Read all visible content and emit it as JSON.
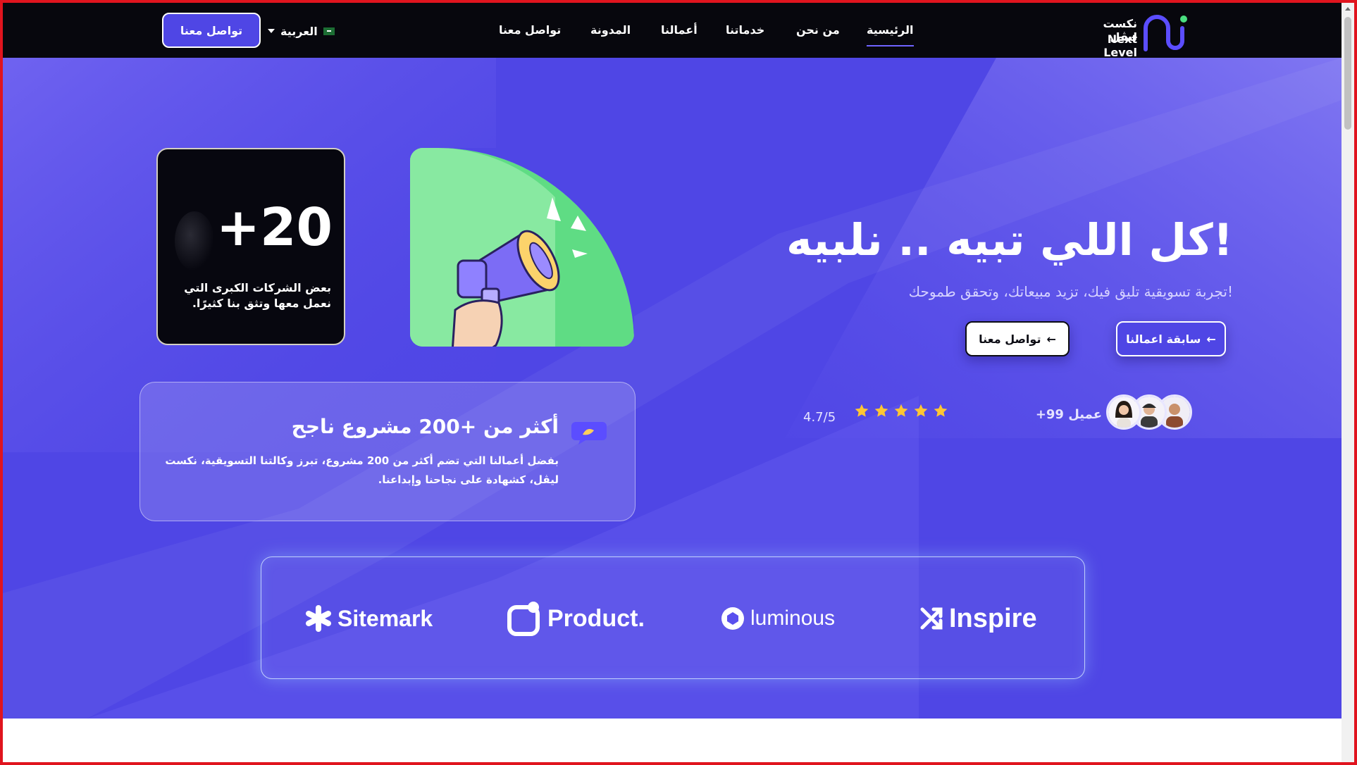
{
  "nav": {
    "logo_ar": "نكست ليڤل",
    "logo_en": "Next Level",
    "links": [
      {
        "label": "الرئيسية",
        "active": true
      },
      {
        "label": "من نحن"
      },
      {
        "label": "خدماتنا"
      },
      {
        "label": "أعمالنا"
      },
      {
        "label": "المدونة"
      },
      {
        "label": "تواصل معنا"
      }
    ],
    "language": "العربية",
    "cta": "تواصل معنا"
  },
  "hero": {
    "title": "كل اللي تبيه .. نلبيه!",
    "subtitle": "تجربة تسويقية تليق فيك، تزيد مبيعاتك، وتحقق طموحك!",
    "btn_works": "سابقة اعمالنا",
    "btn_contact": "تواصل معنا",
    "clients": "+99 عميل",
    "rating": "4.7/5",
    "stars": 5
  },
  "stat_card": {
    "number": "+20",
    "text": "بعض الشركات الكبرى التي نعمل معها وتثق بنا كثيرًا."
  },
  "projects_card": {
    "title": "أكثر من +200 مشروع ناجح",
    "text": "بفضل أعمالنا التي تضم أكثر من 200 مشروع، تبرز وكالتنا التسويقية، نكست ليڤل، كشهادة على نجاحنا وإبداعنا."
  },
  "brands": [
    {
      "name": "Sitemark",
      "icon": "asterisk-icon"
    },
    {
      "name": "Product.",
      "icon": "rounded-square-icon"
    },
    {
      "name": "luminous",
      "icon": "aperture-icon"
    },
    {
      "name": "Inspire",
      "icon": "shuffle-icon"
    }
  ],
  "colors": {
    "hero_bg": "#4f46e5",
    "nav_bg": "#07070d",
    "accent": "#6f63ff",
    "green": "#6ee08c",
    "star": "#ffc633"
  }
}
